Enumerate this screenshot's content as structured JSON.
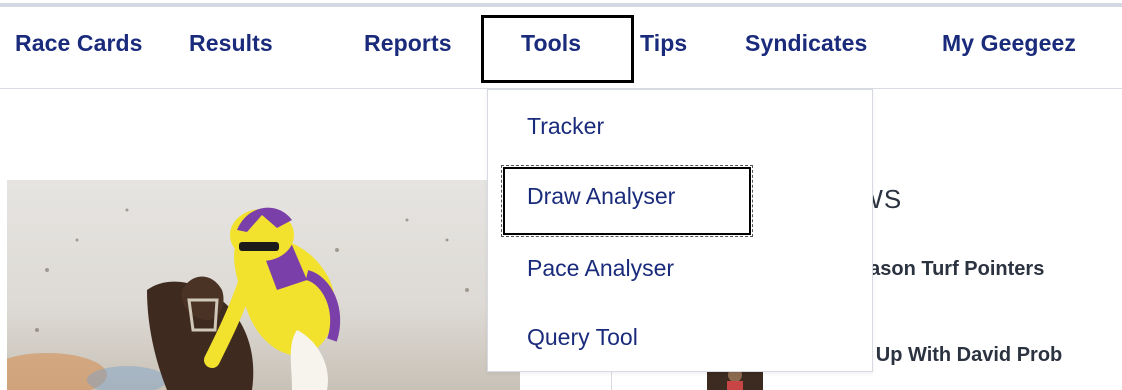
{
  "nav": {
    "items": [
      {
        "label": "Race Cards"
      },
      {
        "label": "Results"
      },
      {
        "label": "Reports"
      },
      {
        "label": "Tools"
      },
      {
        "label": "Tips"
      },
      {
        "label": "Syndicates"
      },
      {
        "label": "My Geegeez"
      }
    ]
  },
  "dropdown": {
    "items": [
      {
        "label": "Tracker"
      },
      {
        "label": "Draw Analyser"
      },
      {
        "label": "Pace Analyser"
      },
      {
        "label": "Query Tool"
      }
    ]
  },
  "news": {
    "heading_visible": "EWS",
    "items": [
      {
        "label_visible": "eason Turf Pointers"
      },
      {
        "label_visible": "g Up With David Prob"
      }
    ]
  },
  "colors": {
    "nav_text": "#1a2b7c",
    "body_text": "#2c3340",
    "rule": "#d9dde3",
    "jockey_silk_yellow": "#f2e22e",
    "jockey_silk_purple": "#7a3fa8"
  }
}
